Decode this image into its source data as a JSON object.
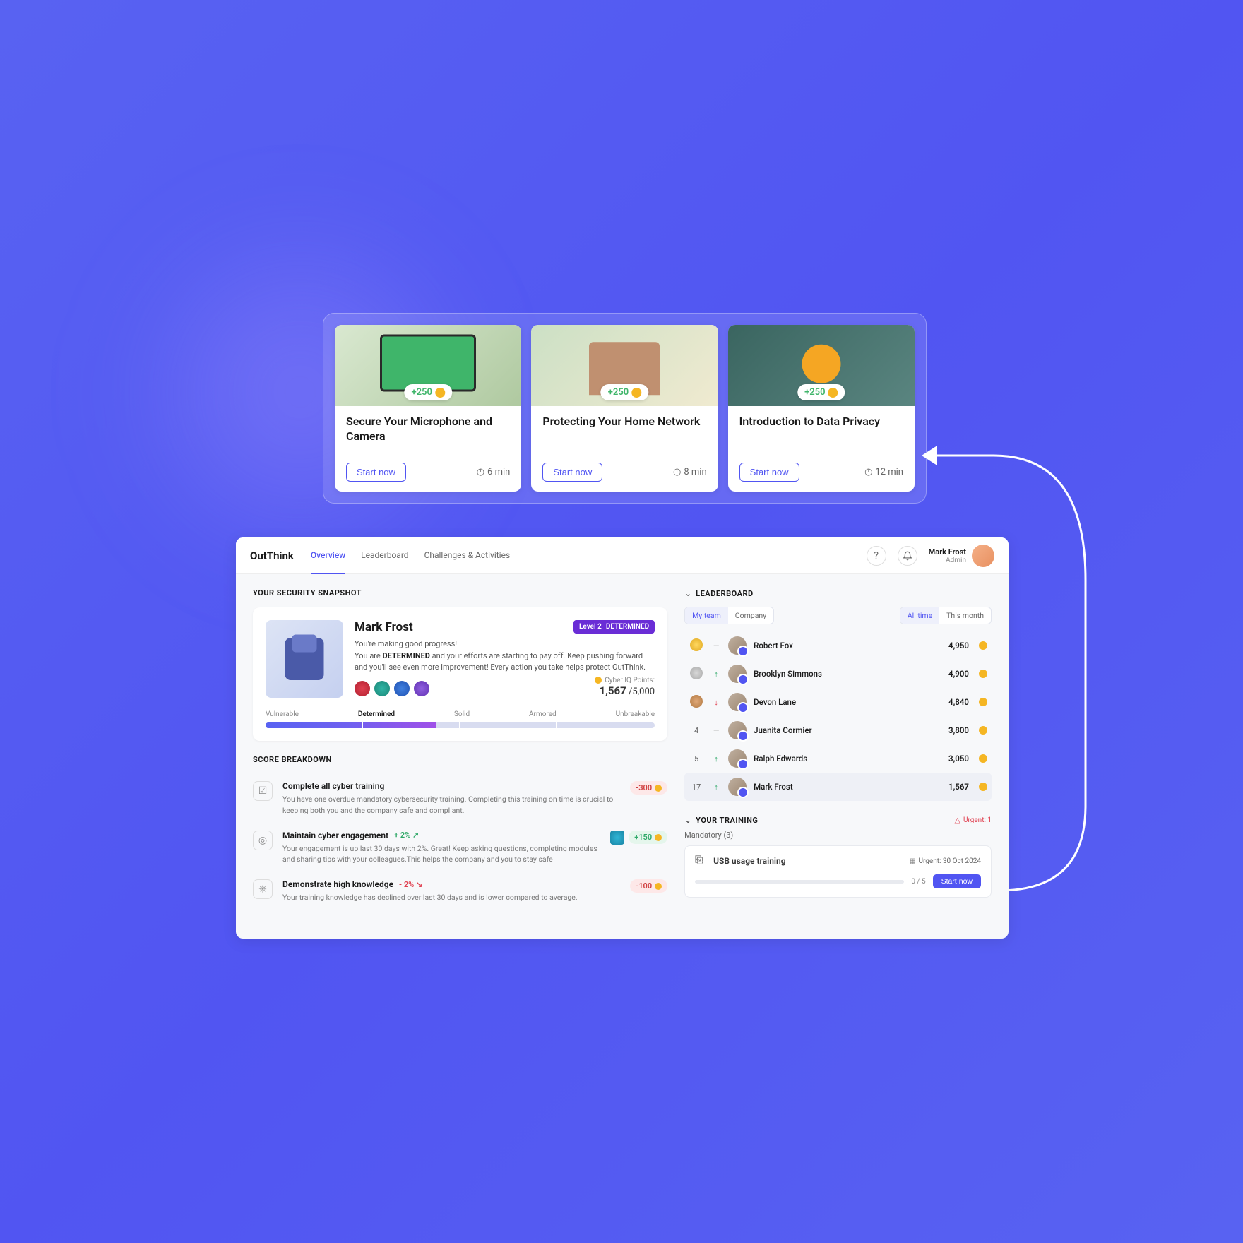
{
  "cards": [
    {
      "points": "+250",
      "title": "Secure Your Microphone and Camera",
      "cta": "Start now",
      "duration": "6 min"
    },
    {
      "points": "+250",
      "title": "Protecting Your Home Network",
      "cta": "Start now",
      "duration": "8 min"
    },
    {
      "points": "+250",
      "title": "Introduction to Data Privacy",
      "cta": "Start now",
      "duration": "12 min"
    }
  ],
  "brand": "OutThink",
  "nav": {
    "overview": "Overview",
    "leaderboard": "Leaderboard",
    "challenges": "Challenges & Activities"
  },
  "user": {
    "name": "Mark Frost",
    "role": "Admin"
  },
  "sections": {
    "snapshot": "YOUR SECURITY SNAPSHOT",
    "breakdown": "SCORE BREAKDOWN",
    "leaderboard": "LEADERBOARD",
    "training": "YOUR TRAINING"
  },
  "snapshot": {
    "name": "Mark Frost",
    "level": "Level 2",
    "level_tag": "DETERMINED",
    "desc1": "You're making good progress!",
    "desc2a": "You are ",
    "desc2b": "DETERMINED",
    "desc2c": " and your efforts are starting to pay off. Keep pushing forward and you'll see even more improvement! Every action you take helps protect OutThink.",
    "points_label": "Cyber IQ Points:",
    "points_value": "1,567",
    "points_total": " /5,000",
    "stages": [
      "Vulnerable",
      "Determined",
      "Solid",
      "Armored",
      "Unbreakable"
    ]
  },
  "breakdown": [
    {
      "icon": "☑",
      "title": "Complete all cyber training",
      "delta": "",
      "dir": "",
      "desc": "You have one overdue mandatory cybersecurity training. Completing this training on time is crucial to keeping both you and the company safe and compliant.",
      "score": "-300",
      "score_kind": "neg",
      "badge": false
    },
    {
      "icon": "◎",
      "title": "Maintain cyber engagement",
      "delta": "+ 2%",
      "dir": "up",
      "desc": "Your engagement is up last 30 days with 2%. Great! Keep asking questions, completing modules and sharing tips with your colleagues.This helps the company and you to stay safe",
      "score": "+150",
      "score_kind": "pos",
      "badge": true
    },
    {
      "icon": "⎈",
      "title": "Demonstrate high knowledge",
      "delta": "- 2%",
      "dir": "down",
      "desc": "Your training knowledge has declined over last 30 days and is lower compared to average.",
      "score": "-100",
      "score_kind": "neg",
      "badge": false
    }
  ],
  "lb_filters": {
    "team": "My team",
    "company": "Company",
    "all": "All time",
    "month": "This month"
  },
  "leaderboard": [
    {
      "rank": "medal-gold",
      "trend": "—",
      "name": "Robert Fox",
      "score": "4,950"
    },
    {
      "rank": "medal-silver",
      "trend": "↑",
      "name": "Brooklyn Simmons",
      "score": "4,900"
    },
    {
      "rank": "medal-bronze",
      "trend": "↓",
      "name": "Devon Lane",
      "score": "4,840"
    },
    {
      "rank": "4",
      "trend": "—",
      "name": "Juanita Cormier",
      "score": "3,800"
    },
    {
      "rank": "5",
      "trend": "↑",
      "name": "Ralph Edwards",
      "score": "3,050"
    },
    {
      "rank": "17",
      "trend": "↑",
      "name": "Mark Frost",
      "score": "1,567",
      "me": true
    }
  ],
  "training": {
    "urgent": "Urgent: 1",
    "mandatory": "Mandatory (3)",
    "item_title": "USB usage training",
    "item_urgent": "Urgent: 30 Oct 2024",
    "progress": "0 / 5",
    "start": "Start now"
  }
}
